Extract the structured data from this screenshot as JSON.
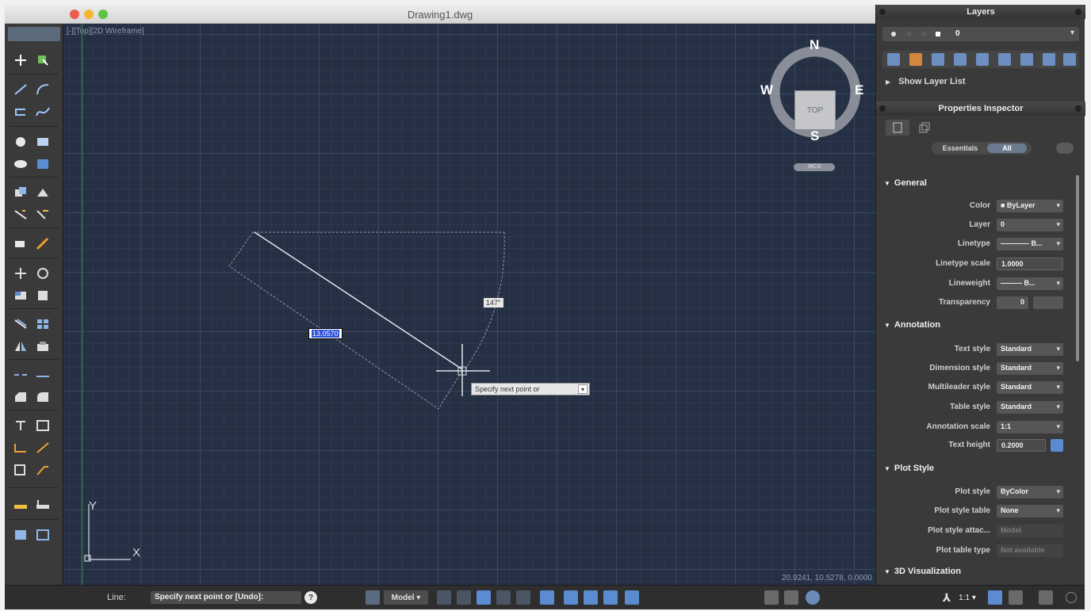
{
  "window": {
    "title": "Drawing1.dwg",
    "viewport_label": "[-][Top][2D Wireframe]",
    "coords": "20.9241, 10.5278, 0.0000"
  },
  "drawing": {
    "length_value": "13.0570",
    "angle_value": "147°",
    "command_tooltip": "Specify next point or",
    "ucs_x": "X",
    "ucs_y": "Y"
  },
  "viewcube": {
    "face": "TOP",
    "north": "N",
    "south": "S",
    "east": "E",
    "west": "W",
    "wcs_label": "WCS"
  },
  "statusbar": {
    "cmd_prefix": "Line:",
    "command_line": "Specify next point or [Undo]:",
    "model_button": "Model",
    "annotation_scale": "1:1"
  },
  "layers_panel": {
    "title": "Layers",
    "current_layer": "0",
    "show_layer_list": "Show Layer List"
  },
  "properties_inspector": {
    "title": "Properties Inspector",
    "tab_essentials": "Essentials",
    "tab_all": "All",
    "sections": {
      "general": "General",
      "annotation": "Annotation",
      "plot_style": "Plot Style",
      "visualization": "3D Visualization"
    },
    "general": [
      {
        "label": "Color",
        "value": "■ ByLayer"
      },
      {
        "label": "Layer",
        "value": "0"
      },
      {
        "label": "Linetype",
        "value": "———— B..."
      },
      {
        "label": "Linetype scale",
        "value": "1.0000"
      },
      {
        "label": "Lineweight",
        "value": "——— B..."
      },
      {
        "label": "Transparency",
        "value": "0"
      }
    ],
    "annotation": [
      {
        "label": "Text style",
        "value": "Standard"
      },
      {
        "label": "Dimension style",
        "value": "Standard"
      },
      {
        "label": "Multileader style",
        "value": "Standard"
      },
      {
        "label": "Table style",
        "value": "Standard"
      },
      {
        "label": "Annotation scale",
        "value": "1:1"
      },
      {
        "label": "Text height",
        "value": "0.2000"
      }
    ],
    "plot_style": [
      {
        "label": "Plot style",
        "value": "ByColor"
      },
      {
        "label": "Plot style table",
        "value": "None"
      },
      {
        "label": "Plot style attac...",
        "value": "Model"
      },
      {
        "label": "Plot table type",
        "value": "Not available"
      }
    ]
  },
  "colors": {
    "canvas_bg": "#253044",
    "grid_major": "#3b475c",
    "accent_blue": "#5b8bd0",
    "traffic_red": "#ee5b52",
    "traffic_yellow": "#f5b530",
    "traffic_green": "#5ec53f"
  }
}
